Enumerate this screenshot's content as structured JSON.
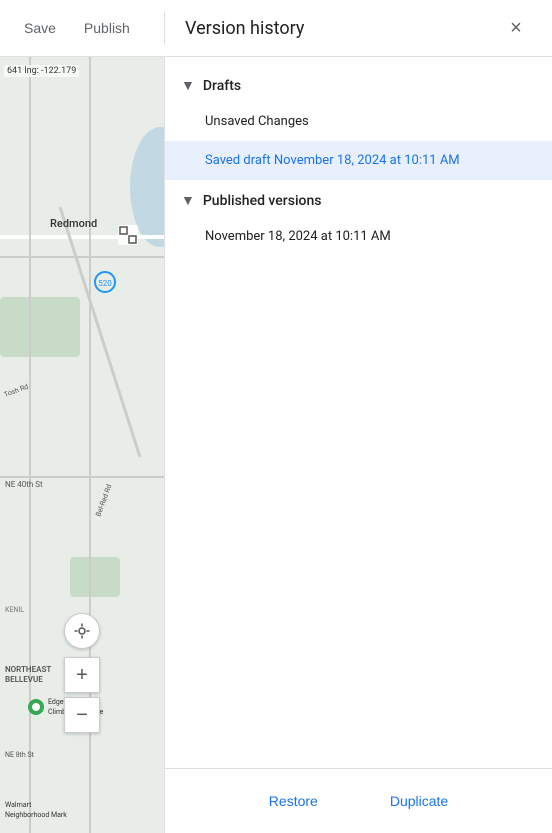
{
  "toolbar": {
    "save_label": "Save",
    "publish_label": "Publish",
    "version_history_title": "Version history",
    "close_icon": "×"
  },
  "map": {
    "coords_lat": "641",
    "coords_lng": "lng: -122.179",
    "label_redmond": "Redmond",
    "label_northeast_bellevue": "NORTHEAST\nBELLEVUE",
    "label_ne40th": "NE 40th St",
    "label_bel_red": "Bel-Red Rd",
    "label_tosh": "Tosh Rd",
    "label_ne8th": "NE 8th St",
    "label_kenil": "KENIL",
    "label_edgeworks": "Edgeworks\nClimbing Bellevue",
    "label_walmart": "Walmart\nNeighborhood Mark",
    "locate_icon": "⊕",
    "zoom_in_label": "+",
    "zoom_out_label": "−"
  },
  "version_panel": {
    "drafts_section": {
      "label": "Drafts",
      "items": [
        {
          "label": "Unsaved Changes",
          "selected": false
        },
        {
          "label": "Saved draft November 18, 2024 at 10:11 AM",
          "selected": true
        }
      ]
    },
    "published_section": {
      "label": "Published versions",
      "items": [
        {
          "label": "November 18, 2024 at 10:11 AM",
          "selected": false
        }
      ]
    }
  },
  "footer": {
    "restore_label": "Restore",
    "duplicate_label": "Duplicate"
  }
}
